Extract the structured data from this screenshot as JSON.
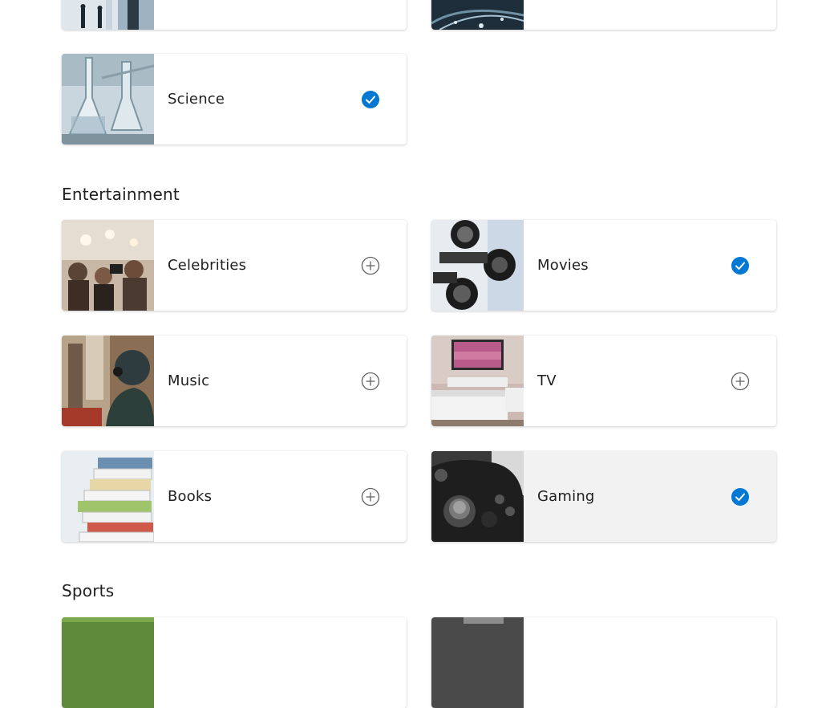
{
  "sections": {
    "entertainment": {
      "heading": "Entertainment"
    },
    "sports": {
      "heading": "Sports"
    }
  },
  "cards": {
    "science": {
      "label": "Science",
      "status": "selected",
      "icon": "check-circle-icon"
    },
    "celebrities": {
      "label": "Celebrities",
      "status": "unselected",
      "icon": "plus-circle-icon"
    },
    "movies": {
      "label": "Movies",
      "status": "selected",
      "icon": "check-circle-icon"
    },
    "music": {
      "label": "Music",
      "status": "unselected",
      "icon": "plus-circle-icon"
    },
    "tv": {
      "label": "TV",
      "status": "unselected",
      "icon": "plus-circle-icon"
    },
    "books": {
      "label": "Books",
      "status": "unselected",
      "icon": "plus-circle-icon"
    },
    "gaming": {
      "label": "Gaming",
      "status": "selected",
      "icon": "check-circle-icon"
    }
  },
  "colors": {
    "accent": "#0078d4",
    "card_background": "#ffffff",
    "hover_background": "#f2f2f2",
    "text": "#1f1f1f"
  }
}
